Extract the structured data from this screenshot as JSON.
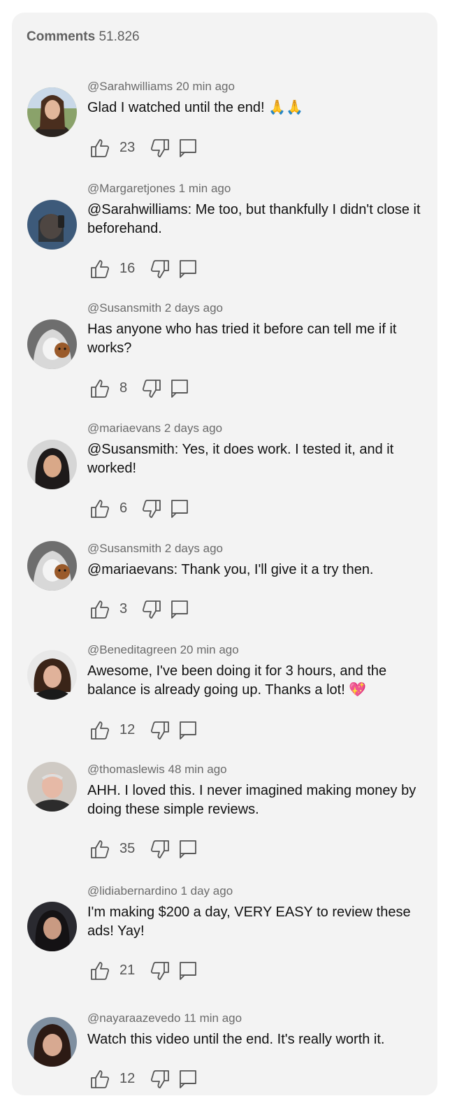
{
  "header": {
    "label": "Comments",
    "count": "51.826"
  },
  "comments": [
    {
      "meta": "@Sarahwilliams 20 min ago",
      "text": "Glad I watched until the end! 🙏🙏",
      "likes": "23"
    },
    {
      "meta": "@Margaretjones 1 min ago",
      "text": "@Sarahwilliams: Me too, but thankfully I didn't close it beforehand.",
      "likes": "16"
    },
    {
      "meta": "@Susansmith 2 days ago",
      "text": "Has anyone who has tried it before can tell me if it works?",
      "likes": "8"
    },
    {
      "meta": "@mariaevans 2 days ago",
      "text": "@Susansmith: Yes, it does work. I tested it, and it worked!",
      "likes": "6"
    },
    {
      "meta": "@Susansmith 2 days ago",
      "text": "@mariaevans: Thank you, I'll give it a try then.",
      "likes": "3"
    },
    {
      "meta": "@Beneditagreen 20 min ago",
      "text": "Awesome, I've been doing it for 3 hours, and the balance is already going up. Thanks a lot! 💖",
      "likes": "12"
    },
    {
      "meta": "@thomaslewis 48 min ago",
      "text": "AHH. I loved this. I never imagined making money by doing these simple reviews.",
      "likes": "35"
    },
    {
      "meta": "@lidiabernardino 1 day ago",
      "text": "I'm making $200 a day, VERY EASY to review these ads! Yay!",
      "likes": "21"
    },
    {
      "meta": "@nayaraazevedo 11 min ago",
      "text": "Watch this video until the end. It's really worth it.",
      "likes": "12"
    }
  ],
  "icons": {
    "like": "thumbs-up-icon",
    "dislike": "thumbs-down-icon",
    "reply": "reply-icon"
  }
}
